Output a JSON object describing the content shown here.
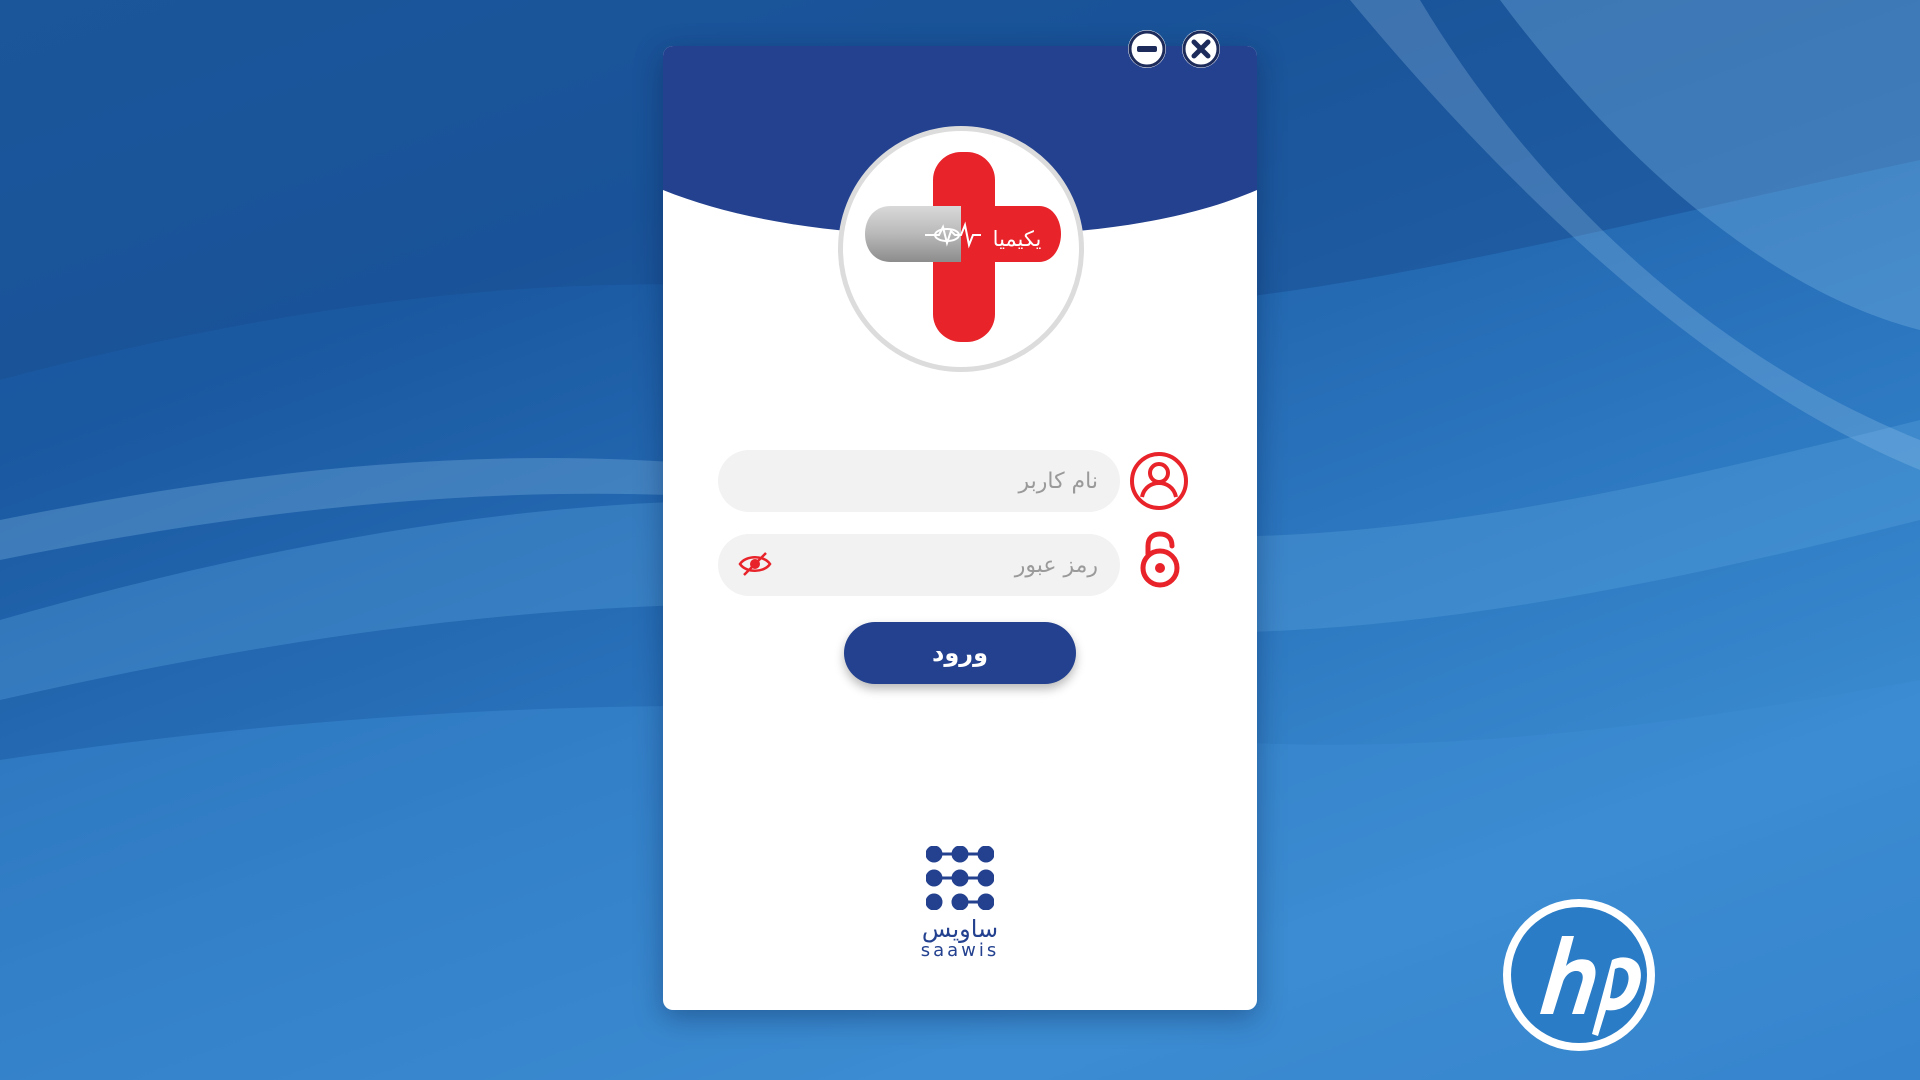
{
  "app": {
    "logo_text": "یکیمیا",
    "colors": {
      "header_blue": "#23418f",
      "accent_red": "#e8232a",
      "field_bg": "#f2f2f2",
      "desktop_blue": "#1d5fa6"
    }
  },
  "window_controls": {
    "minimize_icon": "minus-circle-icon",
    "close_icon": "x-circle-icon"
  },
  "form": {
    "username": {
      "placeholder": "نام کاربر",
      "value": "",
      "icon": "user-icon"
    },
    "password": {
      "placeholder": "رمز عبور",
      "value": "",
      "icon": "lock-icon",
      "toggle_icon": "eye-hidden-icon"
    },
    "login_label": "ورود"
  },
  "brand": {
    "name_fa": "ساویس",
    "name_en": "saawis"
  },
  "desktop": {
    "wallpaper_logo": "hp"
  }
}
